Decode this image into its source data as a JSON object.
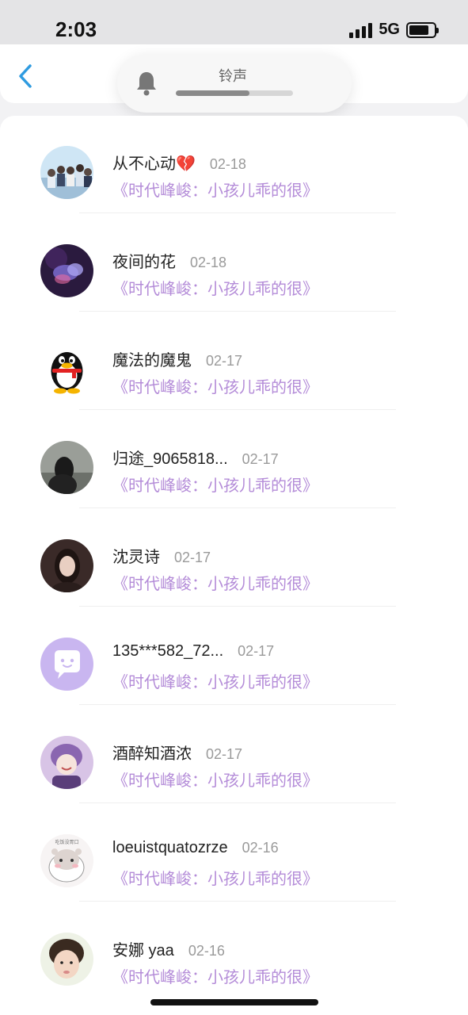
{
  "status_bar": {
    "time": "2:03",
    "network": "5G"
  },
  "header": {
    "back_icon": "chevron-left-icon"
  },
  "ringtone_popup": {
    "label": "铃声",
    "icon": "bell-icon",
    "volume_level": 0.63
  },
  "colors": {
    "accent_blue": "#2f9be0",
    "song_purple": "#b48cd8",
    "name_text": "#222222",
    "date_text": "#9a9a9a"
  },
  "list": [
    {
      "name": "从不心动💔",
      "date": "02-18",
      "song": "《时代峰峻：小孩儿乖的很》",
      "avatar": "group-photo-avatar"
    },
    {
      "name": "夜间的花",
      "date": "02-18",
      "song": "《时代峰峻：小孩儿乖的很》",
      "avatar": "jellyfish-avatar"
    },
    {
      "name": "魔法的魔鬼",
      "date": "02-17",
      "song": "《时代峰峻：小孩儿乖的很》",
      "avatar": "qq-penguin-avatar"
    },
    {
      "name": "归途_9065818...",
      "date": "02-17",
      "song": "《时代峰峻：小孩儿乖的很》",
      "avatar": "girl-photo-avatar"
    },
    {
      "name": "沈灵诗",
      "date": "02-17",
      "song": "《时代峰峻：小孩儿乖的很》",
      "avatar": "portrait-avatar"
    },
    {
      "name": "135***582_72...",
      "date": "02-17",
      "song": "《时代峰峻：小孩儿乖的很》",
      "avatar": "default-chat-avatar"
    },
    {
      "name": "酒醉知酒浓",
      "date": "02-17",
      "song": "《时代峰峻：小孩儿乖的很》",
      "avatar": "anime-avatar"
    },
    {
      "name": "loeuistquatozrze",
      "date": "02-16",
      "song": "《时代峰峻：小孩儿乖的很》",
      "avatar": "hamster-avatar",
      "avatar_caption": "吃饭没胃口"
    },
    {
      "name": "安娜 yaa",
      "date": "02-16",
      "song": "《时代峰峻：小孩儿乖的很》",
      "avatar": "child-photo-avatar"
    }
  ]
}
